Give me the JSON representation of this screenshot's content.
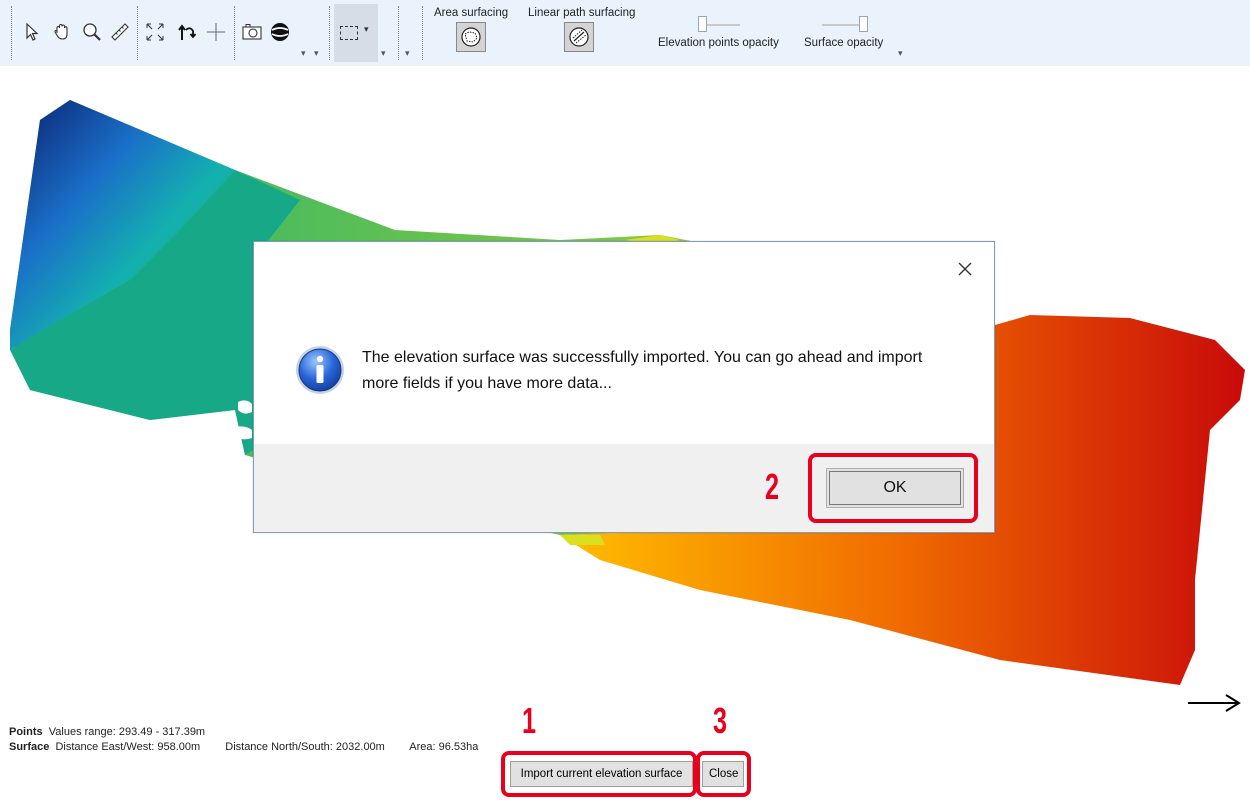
{
  "toolbar": {
    "icons": [
      "select-arrow-icon",
      "pan-hand-icon",
      "zoom-icon",
      "measure-ruler-icon",
      "zoom-extents-icon",
      "rotate-icon",
      "crosshair-icon",
      "camera-icon",
      "globe-icon",
      "selection-rectangle-icon"
    ],
    "area_surfacing_label": "Area surfacing",
    "linear_path_surfacing_label": "Linear path surfacing",
    "elevation_points_opacity_label": "Elevation points opacity",
    "surface_opacity_label": "Surface opacity",
    "elevation_points_opacity": 0.0,
    "surface_opacity": 1.0
  },
  "dialog": {
    "message": "The elevation surface was successfully imported. You can go ahead and import more fields if you have more data...",
    "ok_label": "OK",
    "icon": "info-icon"
  },
  "status": {
    "points_label": "Points",
    "points_range_text": "Values range: 293.49 - 317.39m",
    "surface_label": "Surface",
    "distance_ew_text": "Distance East/West: 958.00m",
    "distance_ns_text": "Distance North/South: 2032.00m",
    "area_text": "Area: 96.53ha"
  },
  "buttons": {
    "import_label": "Import current elevation surface",
    "close_label": "Close"
  },
  "annotations": {
    "step1": "1",
    "step2": "2",
    "step3": "3",
    "highlight_color": "#e8001c"
  }
}
